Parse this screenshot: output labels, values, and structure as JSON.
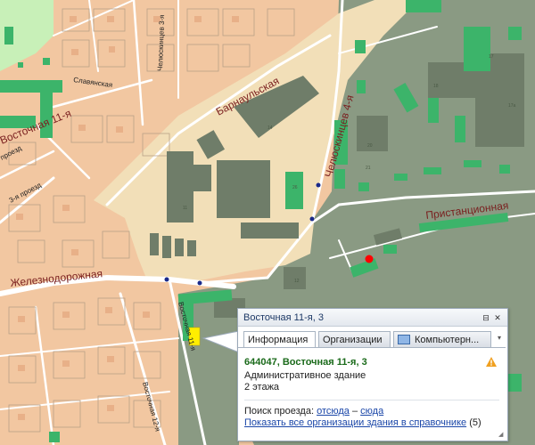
{
  "map": {
    "streets": {
      "barnaulskaya": "Барнаульская",
      "chelyuskintsev_4": "Челюскинцев 4-я",
      "chelyuskintsev_3": "Челюскинцев 3-я",
      "slavyanskaya": "Славянская",
      "vostochnaya_11": "Восточная 11-я",
      "proezd_3": "3-я проезд",
      "proezd": "проезд",
      "pristantsionnaya": "Пристанционная",
      "zheleznodorozhnaya": "Железнодорожная",
      "vostochnaya_12": "Восточная 12-я",
      "vostochnaya": "Восточная 11-я"
    },
    "building_numbers": [
      "14",
      "11",
      "17",
      "17а",
      "18",
      "20",
      "21",
      "26",
      "12"
    ],
    "colors": {
      "land": "#f2c7a1",
      "industrial": "#8a9a83",
      "yard": "#f2dfb8",
      "green_zone": "#c8f0b8",
      "building_green": "#3cb46a",
      "building_gray": "#6f7d69",
      "road": "#ffffff",
      "marker": "#ff0000",
      "highlight": "#ffee00"
    },
    "marker_icon": "red-dot-marker"
  },
  "popup": {
    "title": "Восточная 11-я, 3",
    "tabs": [
      {
        "label": "Информация",
        "active": true
      },
      {
        "label": "Организации",
        "active": false
      },
      {
        "label": "Компьютерн...",
        "active": false,
        "icon": "computer-icon"
      }
    ],
    "address": "644047, Восточная 11-я, 3",
    "type": "Административное здание",
    "floors": "2 этажа",
    "route_label": "Поиск проезда:",
    "route_from": "отсюда",
    "route_dash": "–",
    "route_to": "сюда",
    "show_all": "Показать все организации здания в справочнике",
    "show_all_count": "(5)"
  }
}
